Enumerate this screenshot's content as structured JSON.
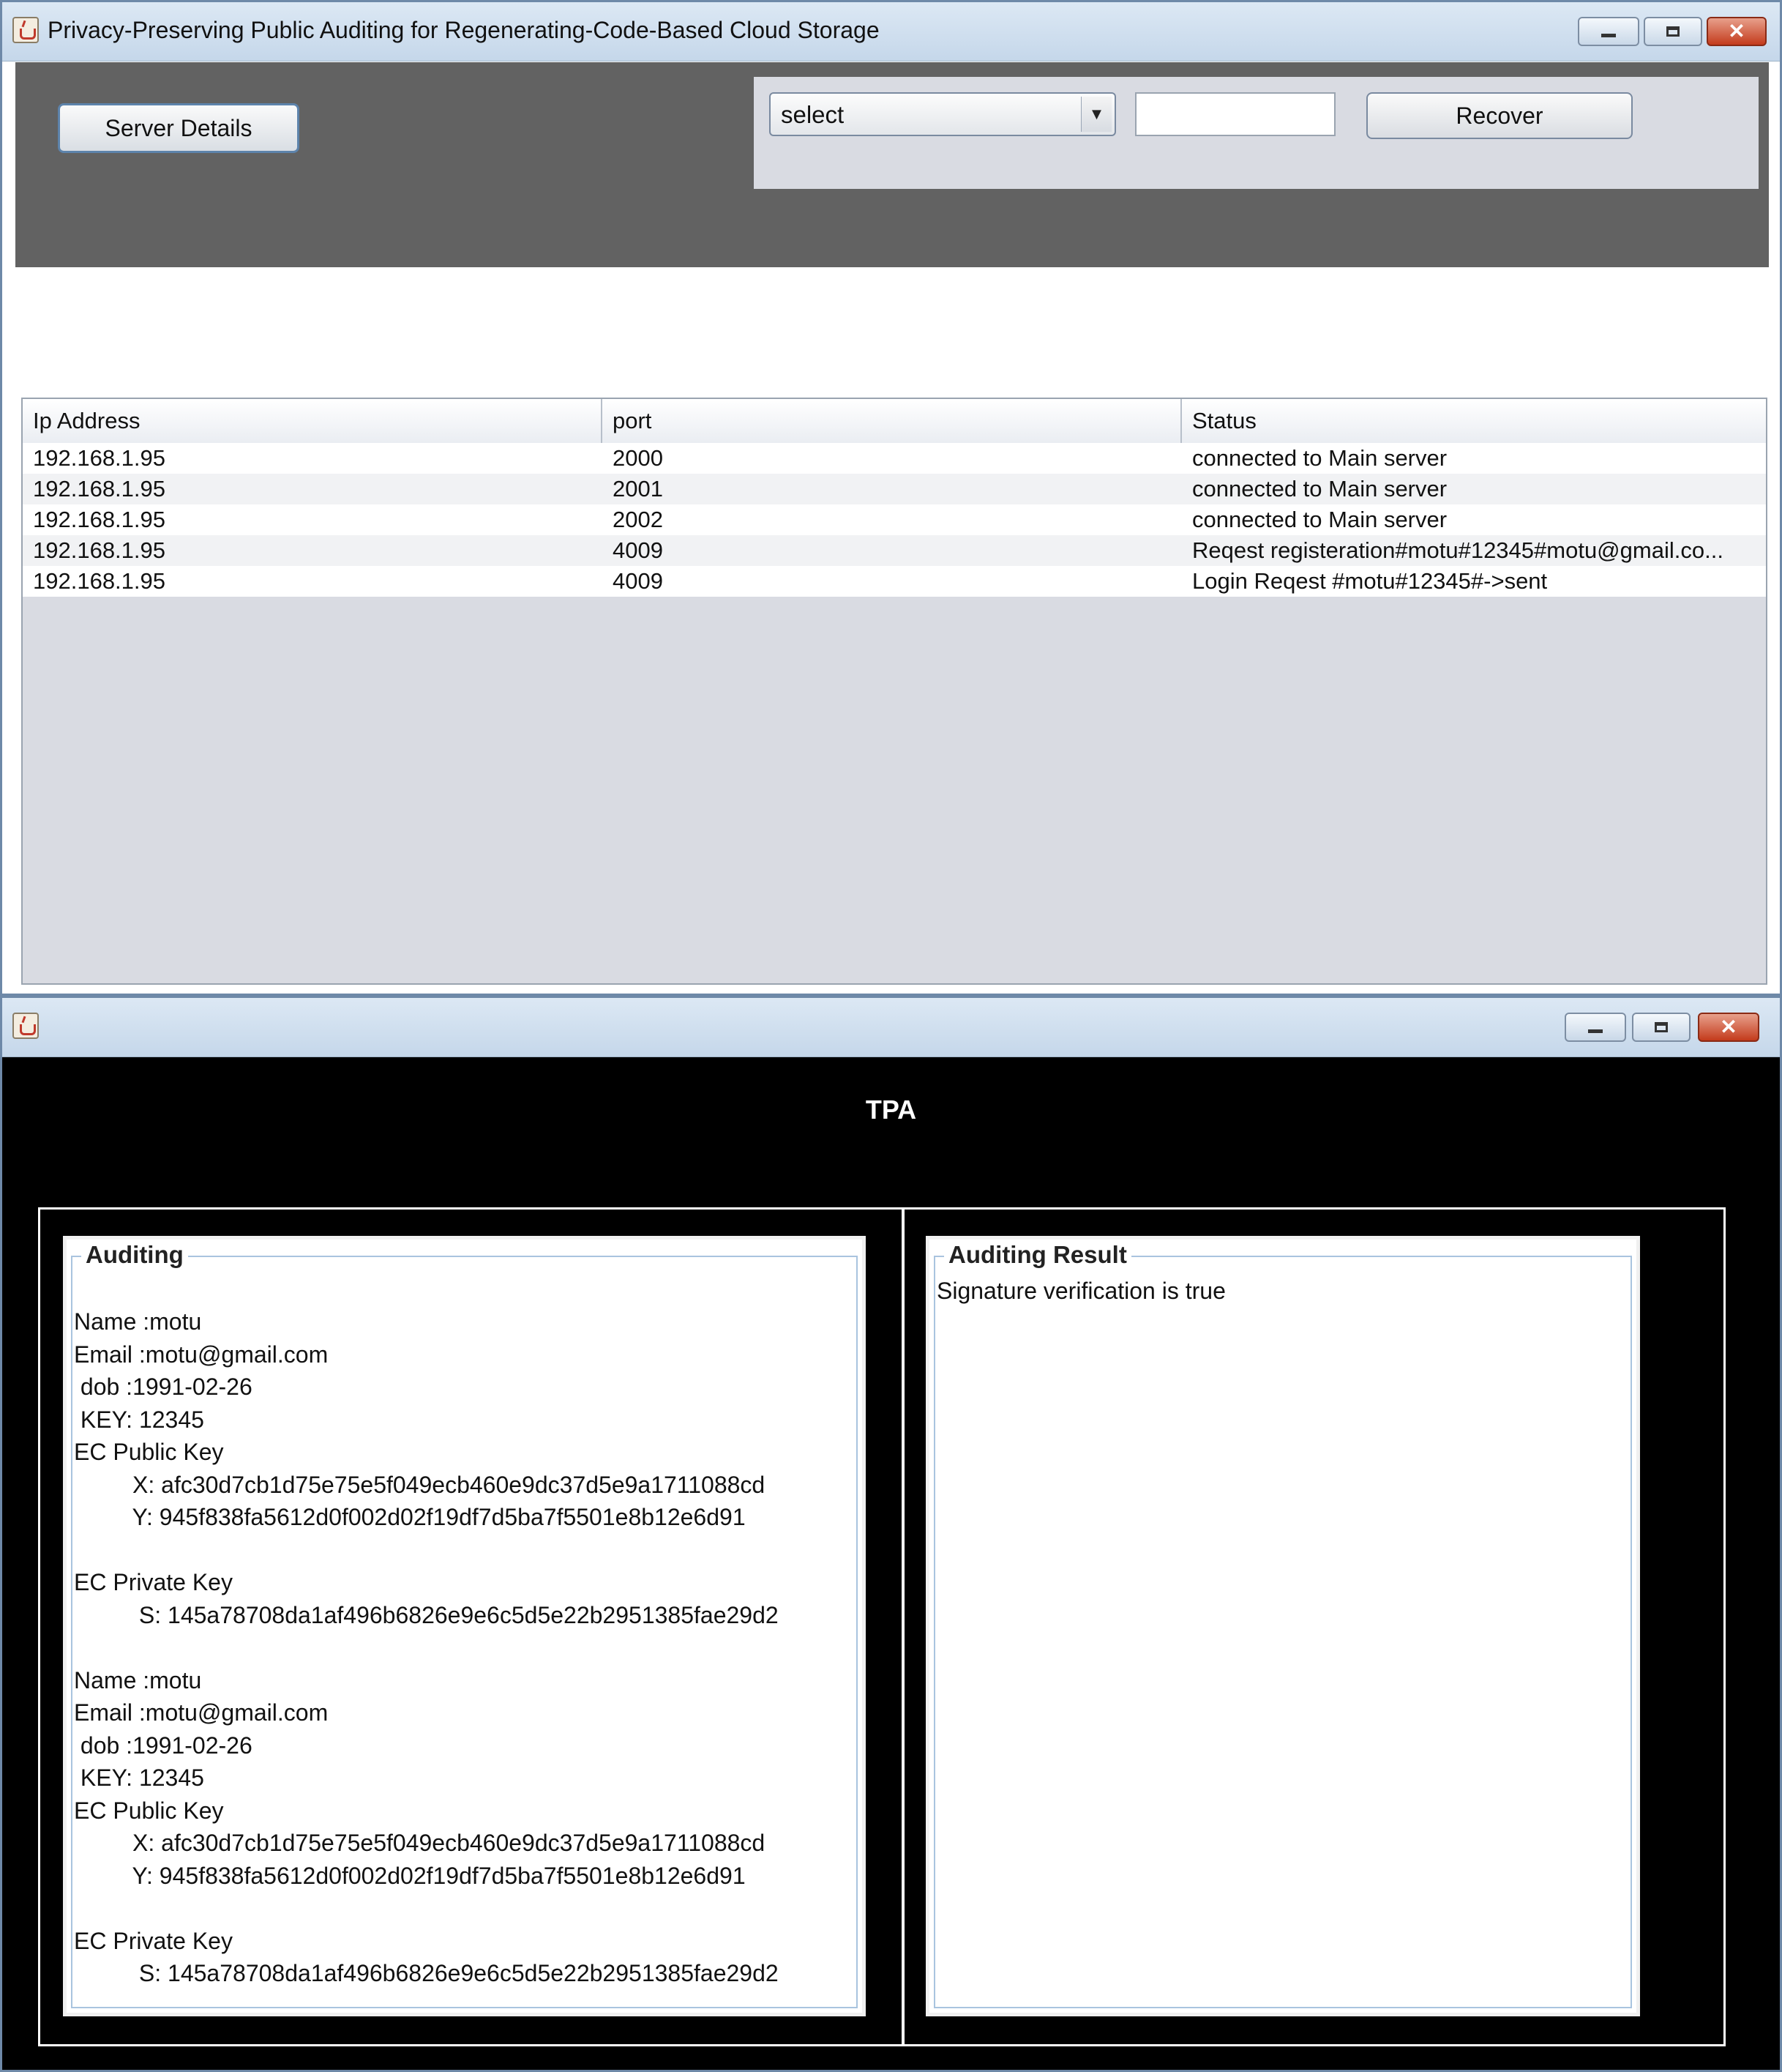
{
  "window1": {
    "title": "Privacy-Preserving Public Auditing for Regenerating-Code-Based Cloud Storage",
    "server_details_button": "Server Details",
    "select_value": "select",
    "input_value": "",
    "recover_button": "Recover",
    "table": {
      "headers": [
        "Ip Address",
        "port",
        "Status"
      ],
      "rows": [
        [
          "192.168.1.95",
          "2000",
          "connected to Main server"
        ],
        [
          "192.168.1.95",
          "2001",
          "connected to Main server"
        ],
        [
          "192.168.1.95",
          "2002",
          "connected to Main server"
        ],
        [
          "192.168.1.95",
          "4009",
          "Reqest registeration#motu#12345#motu@gmail.co..."
        ],
        [
          "192.168.1.95",
          "4009",
          "Login Reqest #motu#12345#->sent"
        ]
      ]
    }
  },
  "window2": {
    "title": "",
    "heading": "TPA",
    "auditing_legend": "Auditing",
    "auditing_text": "Name :motu\nEmail :motu@gmail.com\n dob :1991-02-26\n KEY: 12345\nEC Public Key\n         X: afc30d7cb1d75e75e5f049ecb460e9dc37d5e9a1711088cd\n         Y: 945f838fa5612d0f002d02f19df7d5ba7f5501e8b12e6d91\n\nEC Private Key\n          S: 145a78708da1af496b6826e9e6c5d5e22b2951385fae29d2\n\nName :motu\nEmail :motu@gmail.com\n dob :1991-02-26\n KEY: 12345\nEC Public Key\n         X: afc30d7cb1d75e75e5f049ecb460e9dc37d5e9a1711088cd\n         Y: 945f838fa5612d0f002d02f19df7d5ba7f5501e8b12e6d91\n\nEC Private Key\n          S: 145a78708da1af496b6826e9e6c5d5e22b2951385fae29d2",
    "result_legend": "Auditing Result",
    "result_text": "Signature verification is true"
  },
  "icons": {
    "app": "java-cup-icon",
    "minimize": "minimize-icon",
    "maximize": "maximize-icon",
    "close": "close-icon"
  },
  "colors": {
    "dark_panel": "#626262",
    "control_panel": "#d9dbe2",
    "tpa_background": "#000000",
    "close_button": "#c43b1c"
  }
}
